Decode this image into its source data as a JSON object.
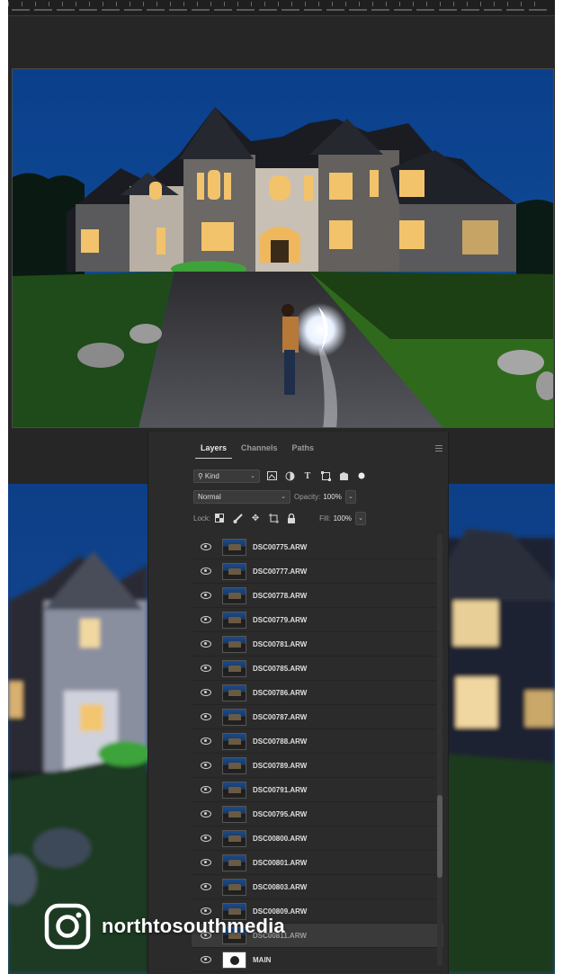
{
  "layers_panel": {
    "tabs": [
      {
        "label": "Layers",
        "active": true
      },
      {
        "label": "Channels",
        "active": false
      },
      {
        "label": "Paths",
        "active": false
      }
    ],
    "filter": {
      "label": "Kind",
      "icon": "search-icon"
    },
    "blend_mode": "Normal",
    "opacity": {
      "label": "Opacity:",
      "value": "100%"
    },
    "lock": {
      "label": "Lock:"
    },
    "fill": {
      "label": "Fill:",
      "value": "100%"
    },
    "layers": [
      {
        "name": "DSC00775.ARW",
        "visible": true
      },
      {
        "name": "DSC00777.ARW",
        "visible": true
      },
      {
        "name": "DSC00778.ARW",
        "visible": true
      },
      {
        "name": "DSC00779.ARW",
        "visible": true
      },
      {
        "name": "DSC00781.ARW",
        "visible": true
      },
      {
        "name": "DSC00785.ARW",
        "visible": true
      },
      {
        "name": "DSC00786.ARW",
        "visible": true
      },
      {
        "name": "DSC00787.ARW",
        "visible": true
      },
      {
        "name": "DSC00788.ARW",
        "visible": true
      },
      {
        "name": "DSC00789.ARW",
        "visible": true
      },
      {
        "name": "DSC00791.ARW",
        "visible": true
      },
      {
        "name": "DSC00795.ARW",
        "visible": true
      },
      {
        "name": "DSC00800.ARW",
        "visible": true
      },
      {
        "name": "DSC00801.ARW",
        "visible": true
      },
      {
        "name": "DSC00803.ARW",
        "visible": true
      },
      {
        "name": "DSC00809.ARW",
        "visible": true
      },
      {
        "name": "DSC00811.ARW",
        "visible": true
      },
      {
        "name": "MAIN",
        "visible": true
      }
    ]
  },
  "watermark": {
    "handle": "northtosouthmedia",
    "icon": "instagram-icon"
  },
  "colors": {
    "panel_bg": "#2b2b2b",
    "sky": "#0d3a7a",
    "window_glow": "#f2c36b",
    "grass": "#2f6a1c"
  }
}
